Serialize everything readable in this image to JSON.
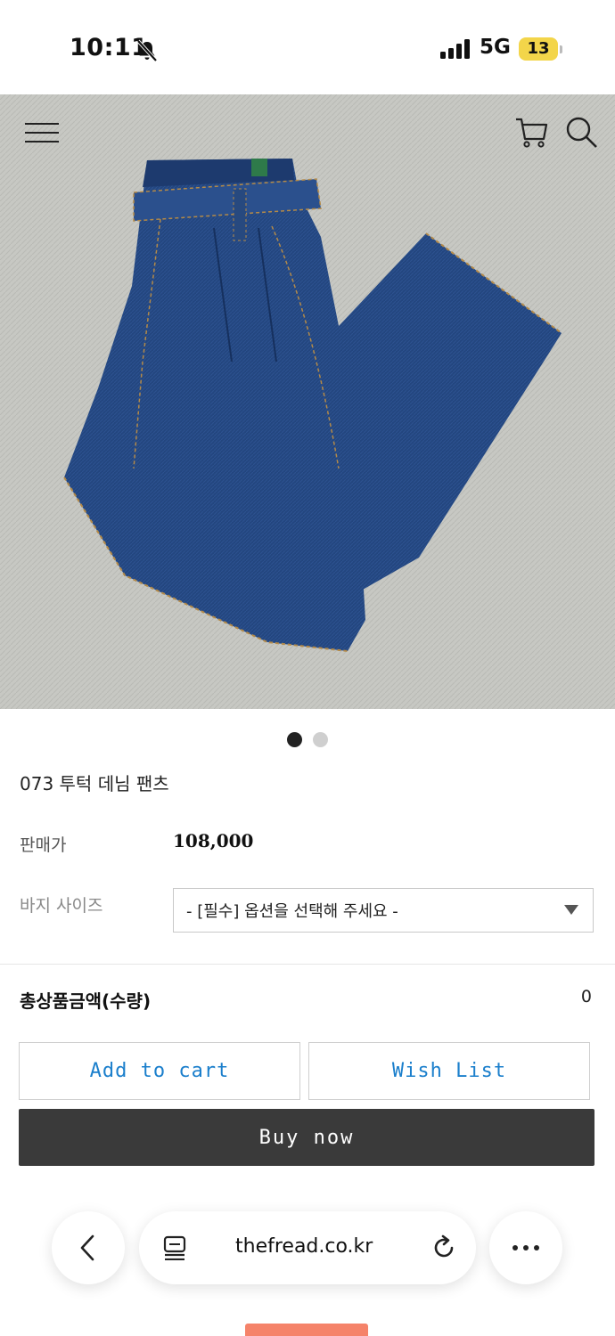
{
  "status_bar": {
    "time": "10:11",
    "network": "5G",
    "battery": "13"
  },
  "header": {
    "icons": [
      "menu-icon",
      "cart-icon",
      "search-icon"
    ]
  },
  "carousel": {
    "total_images": 2,
    "active_index": 0
  },
  "product": {
    "name": "073 투턱 데님 팬츠",
    "price_label": "판매가",
    "price": "108,000",
    "option_label": "바지 사이즈",
    "option_placeholder": "- [필수] 옵션을 선택해 주세요 -"
  },
  "summary": {
    "total_label": "총상품금액(수량)",
    "total_value": "0"
  },
  "actions": {
    "add_to_cart": "Add to cart",
    "wish_list": "Wish List",
    "buy_now": "Buy now"
  },
  "browser": {
    "url": "thefread.co.kr"
  },
  "colors": {
    "accent_link": "#1b7fcc",
    "buy_button": "#3a3a3a",
    "denim": "#1f3f78",
    "battery": "#f3d54a"
  }
}
